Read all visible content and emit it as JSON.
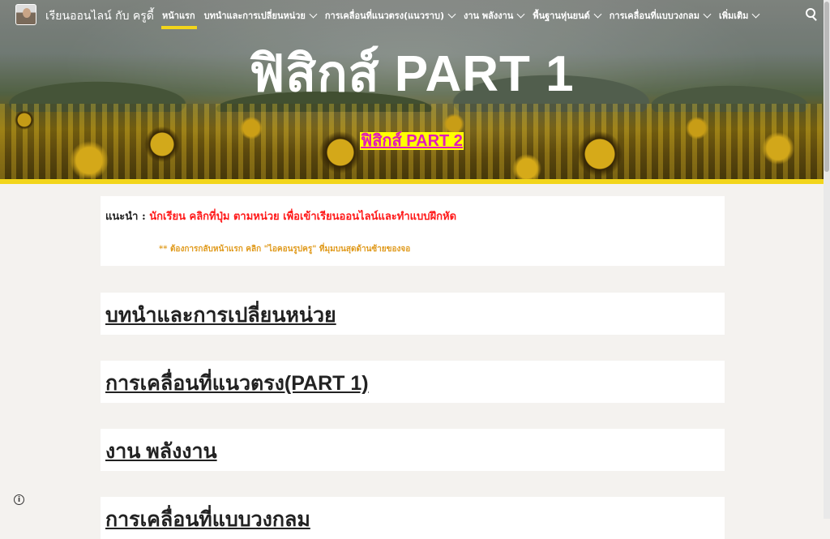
{
  "site": {
    "title": "เรียนออนไลน์ กับ ครูดี้"
  },
  "nav": {
    "items": [
      {
        "label": "หน้าแรก",
        "active": true,
        "has_dropdown": false
      },
      {
        "label": "บทนำและการเปลี่ยนหน่วย",
        "active": false,
        "has_dropdown": true
      },
      {
        "label": "การเคลื่อนที่แนวตรง(แนวราบ)",
        "active": false,
        "has_dropdown": true
      },
      {
        "label": "งาน พลังงาน",
        "active": false,
        "has_dropdown": true
      },
      {
        "label": "พื้นฐานหุ่นยนต์",
        "active": false,
        "has_dropdown": true
      },
      {
        "label": "การเคลื่อนที่แบบวงกลม",
        "active": false,
        "has_dropdown": true
      },
      {
        "label": "เพิ่มเติม",
        "active": false,
        "has_dropdown": true
      }
    ],
    "search_icon": "search-icon"
  },
  "hero": {
    "title": "ฟิสิกส์  PART 1",
    "link": "ฟิสิกส์ PART 2"
  },
  "note": {
    "label": "แนะนำ : ",
    "text": "นักเรียน คลิกที่ปุ่ม ตามหน่วย เพื่อเข้าเรียนออนไลน์และทำแบบฝึกหัด",
    "hint": "** ต้องการกลับหน้าแรก คลิก  \"ไอคอนรูปครู\"  ที่มุมบนสุดด้านซ้ายของจอ"
  },
  "sections": [
    {
      "title": "บทนำและการเปลี่ยนหน่วย"
    },
    {
      "title": "การเคลื่อนที่แนวตรง(PART 1)"
    },
    {
      "title": "งาน พลังงาน"
    },
    {
      "title": "การเคลื่อนที่แบบวงกลม"
    }
  ],
  "colors": {
    "accent": "#f2d51b",
    "link_highlight": "#ffff00",
    "link_text": "#e01bb8",
    "note_red": "#ff1a1a",
    "note_orange": "#e09a1c"
  }
}
